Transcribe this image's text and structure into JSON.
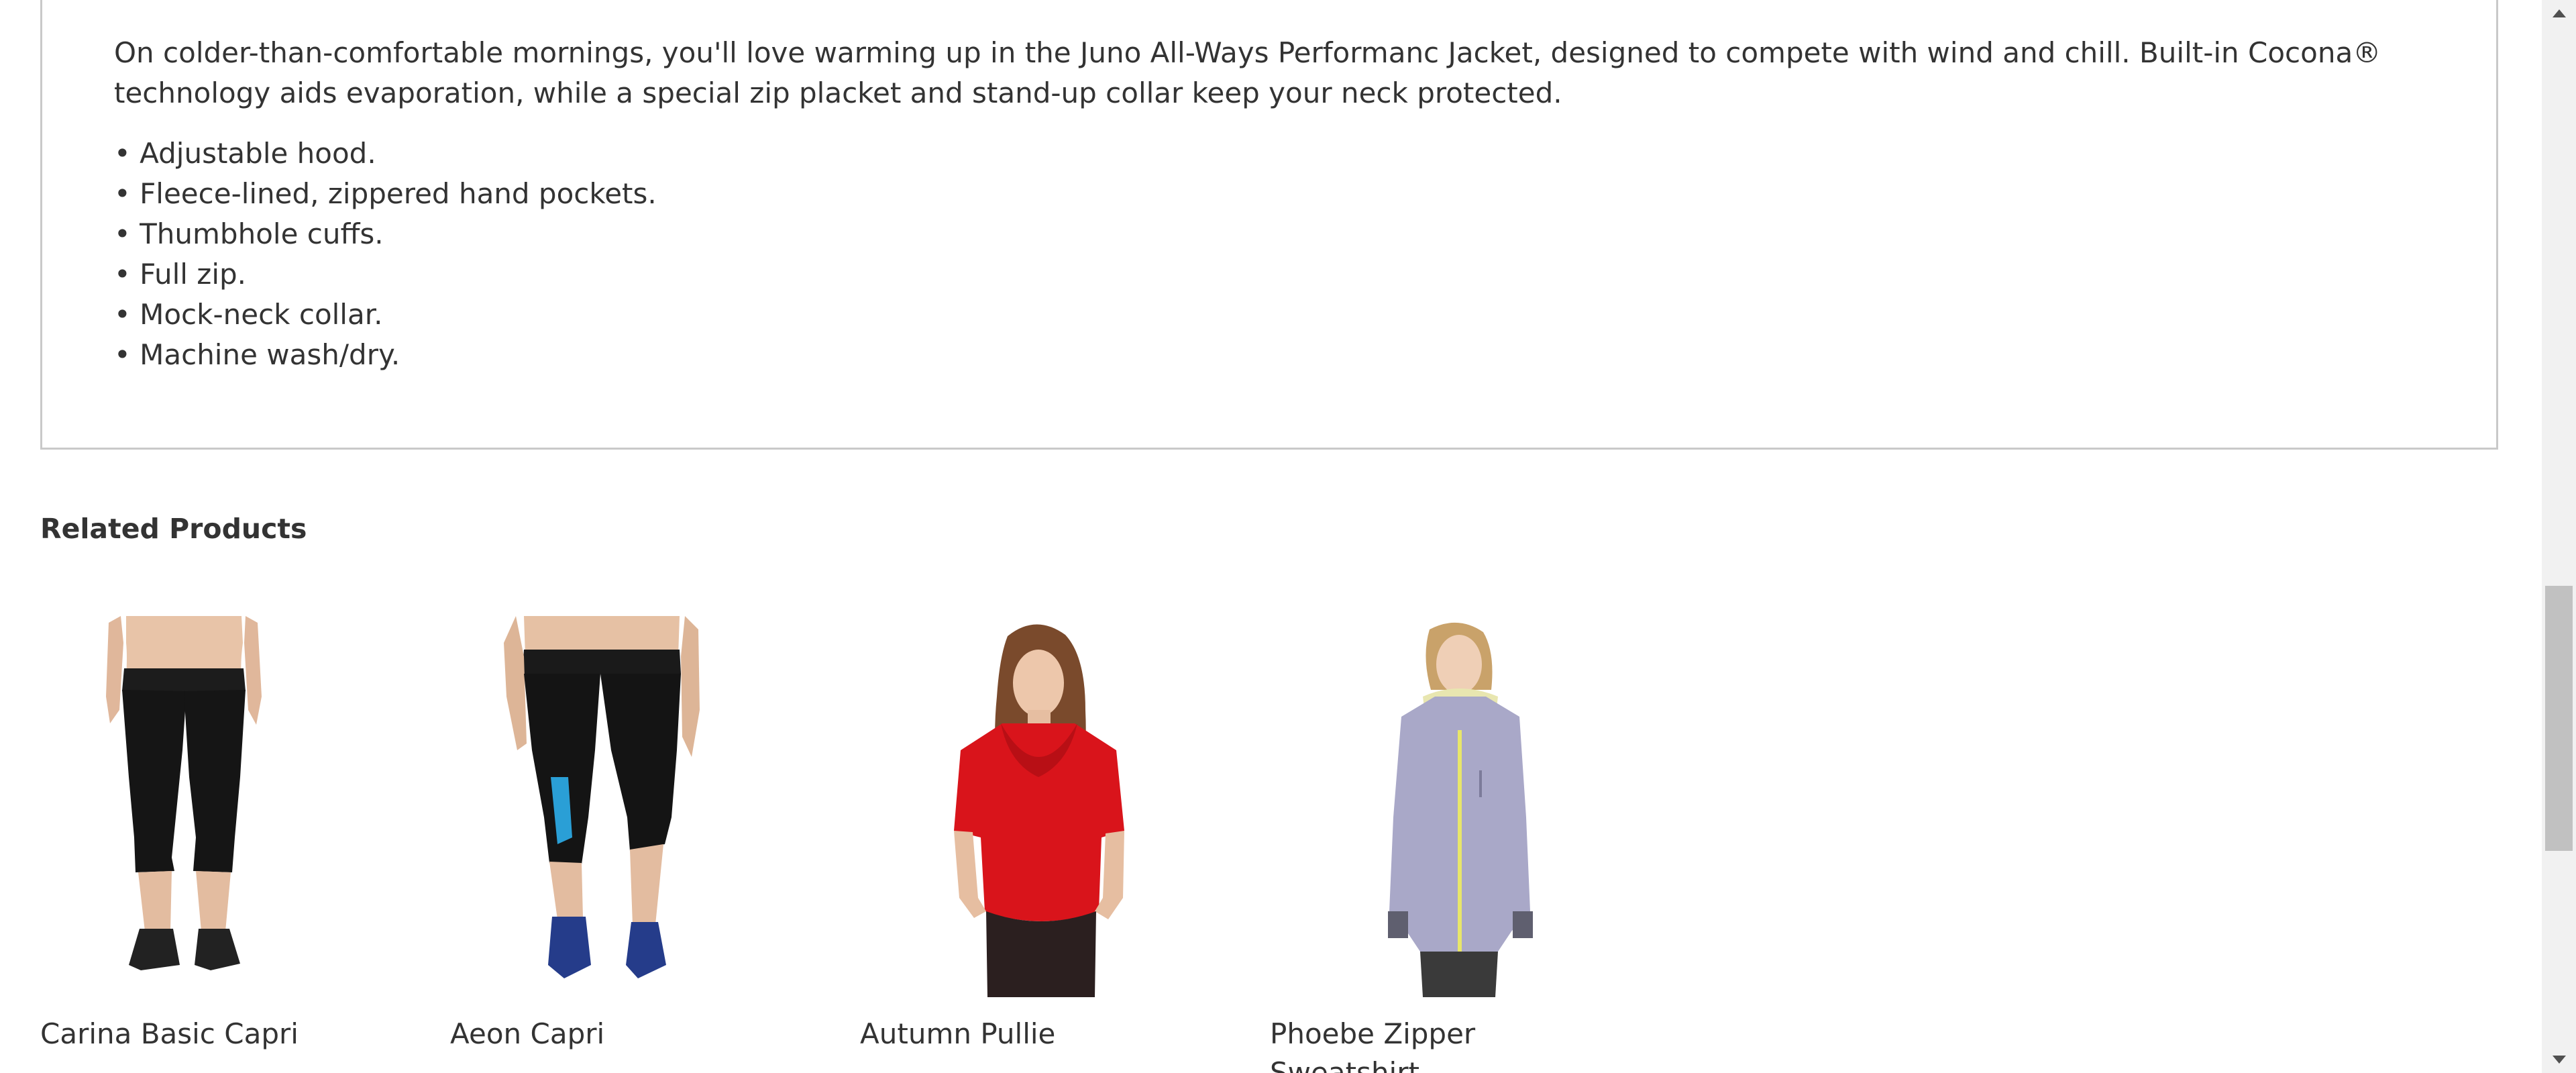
{
  "description": {
    "paragraph": "On colder-than-comfortable mornings, you'll love warming up in the Juno All-Ways Performanc Jacket, designed to compete with wind and chill. Built-in Cocona® technology aids evaporation, while a special zip placket and stand-up collar keep your neck protected.",
    "bullets": [
      "• Adjustable hood.",
      "• Fleece-lined, zippered hand pockets.",
      "• Thumbhole cuffs.",
      "• Full zip.",
      "• Mock-neck collar.",
      "• Machine wash/dry."
    ]
  },
  "related": {
    "title": "Related Products",
    "products": [
      {
        "name": "Carina Basic Capri"
      },
      {
        "name": "Aeon Capri"
      },
      {
        "name": "Autumn Pullie"
      },
      {
        "name": "Phoebe Zipper Sweatshirt"
      }
    ]
  },
  "colors": {
    "text": "#333333",
    "border": "#c9c9c9",
    "scrollbar_track": "#f1f1f1",
    "scrollbar_thumb": "#c1c1c1"
  }
}
